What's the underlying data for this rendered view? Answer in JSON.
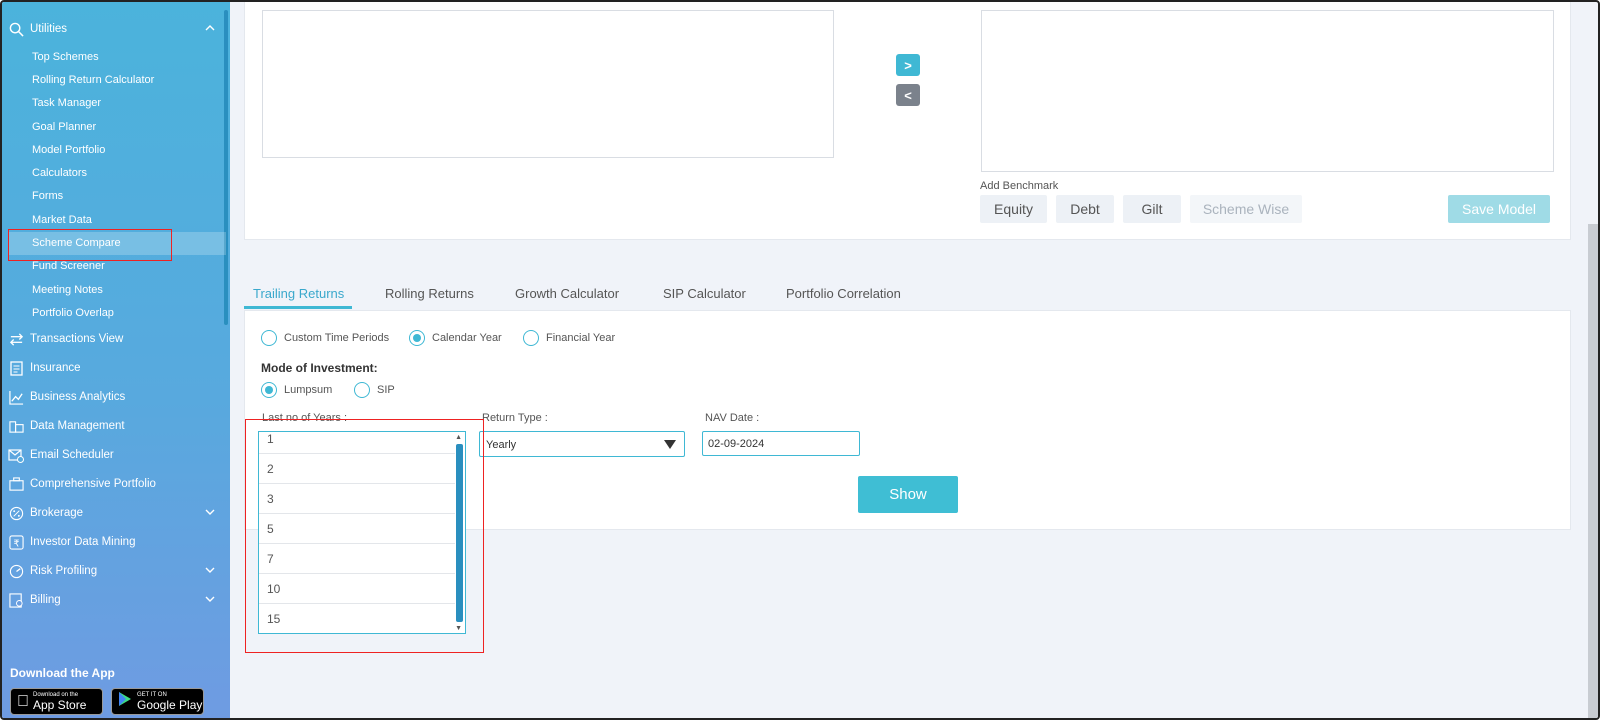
{
  "sidebar": {
    "utilities": {
      "label": "Utilities",
      "items": [
        "Top Schemes",
        "Rolling Return Calculator",
        "Task Manager",
        "Goal Planner",
        "Model Portfolio",
        "Calculators",
        "Forms",
        "Market Data",
        "Scheme Compare",
        "Fund Screener",
        "Meeting Notes",
        "Portfolio Overlap"
      ]
    },
    "sections": [
      {
        "label": "Transactions View"
      },
      {
        "label": "Insurance"
      },
      {
        "label": "Business Analytics"
      },
      {
        "label": "Data Management"
      },
      {
        "label": "Email Scheduler"
      },
      {
        "label": "Comprehensive Portfolio"
      },
      {
        "label": "Brokerage"
      },
      {
        "label": "Investor Data Mining"
      },
      {
        "label": "Risk Profiling"
      },
      {
        "label": "Billing"
      }
    ],
    "download_title": "Download the App",
    "app_store": {
      "small": "Download on the",
      "big": "App Store"
    },
    "google_play": {
      "small": "GET IT ON",
      "big": "Google Play"
    }
  },
  "transfer": {
    "add": ">",
    "remove": "<"
  },
  "benchmark": {
    "label": "Add Benchmark",
    "buttons": [
      "Equity",
      "Debt",
      "Gilt",
      "Scheme Wise"
    ],
    "save": "Save Model"
  },
  "tabs": [
    "Trailing Returns",
    "Rolling Returns",
    "Growth Calculator",
    "SIP Calculator",
    "Portfolio Correlation"
  ],
  "period_options": [
    "Custom Time Periods",
    "Calendar Year",
    "Financial Year"
  ],
  "period_selected": "Calendar Year",
  "mode": {
    "label": "Mode of Investment:",
    "options": [
      "Lumpsum",
      "SIP"
    ],
    "selected": "Lumpsum"
  },
  "fields": {
    "years_label": "Last no of Years :",
    "years_options": [
      "1",
      "2",
      "3",
      "5",
      "7",
      "10",
      "15"
    ],
    "return_type_label": "Return Type :",
    "return_type_value": "Yearly",
    "nav_label": "NAV Date :",
    "nav_value": "02-09-2024"
  },
  "show_button": "Show",
  "colors": {
    "accent": "#3fb8d4",
    "highlight": "#ee2222"
  }
}
